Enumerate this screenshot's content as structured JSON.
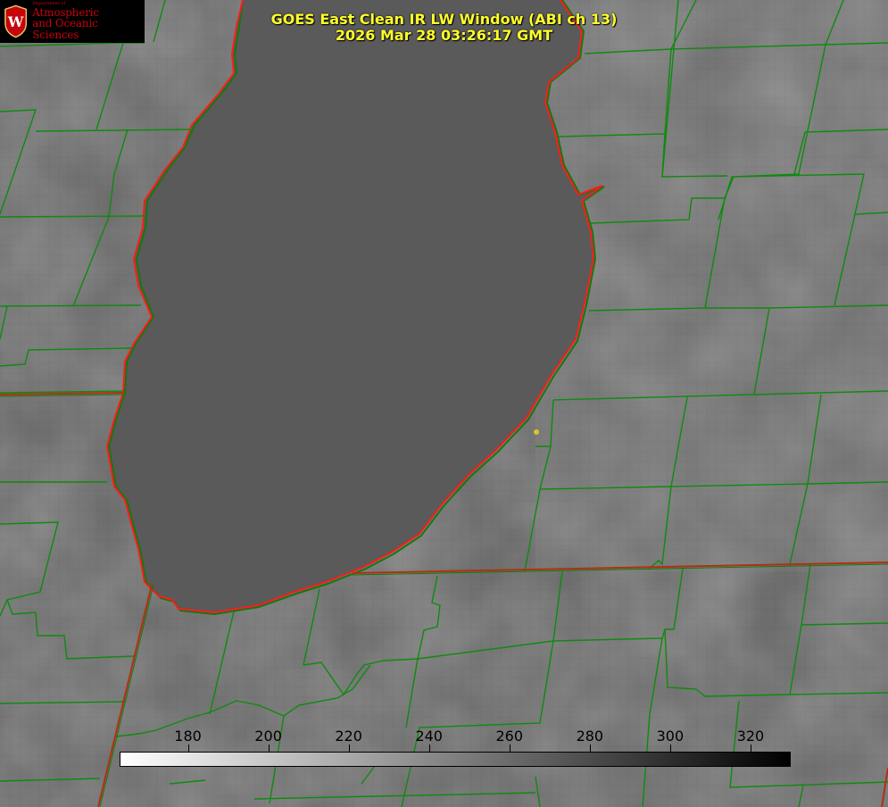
{
  "header": {
    "logo": {
      "department": "Department of",
      "line1": "Atmospheric",
      "line2": "and Oceanic Sciences",
      "seal_letter": "W",
      "color": "#c5050c"
    },
    "title_line1": "GOES East Clean IR LW Window (ABI ch 13)",
    "title_line2": "2026 Mar 28 03:26:17 GMT",
    "title_color": "#ffff2a"
  },
  "map": {
    "coastline_colors": [
      "#ff1a1a",
      "#0f7a0f"
    ],
    "boundary_color": "#0f8a0f",
    "state_line_color": "#b03010",
    "marker_color": "#d8c820"
  },
  "colorbar": {
    "min": 163,
    "max": 330,
    "ticks": [
      "180",
      "200",
      "220",
      "240",
      "260",
      "280",
      "300",
      "320"
    ],
    "gradient": [
      "#ffffff",
      "#000000"
    ]
  }
}
